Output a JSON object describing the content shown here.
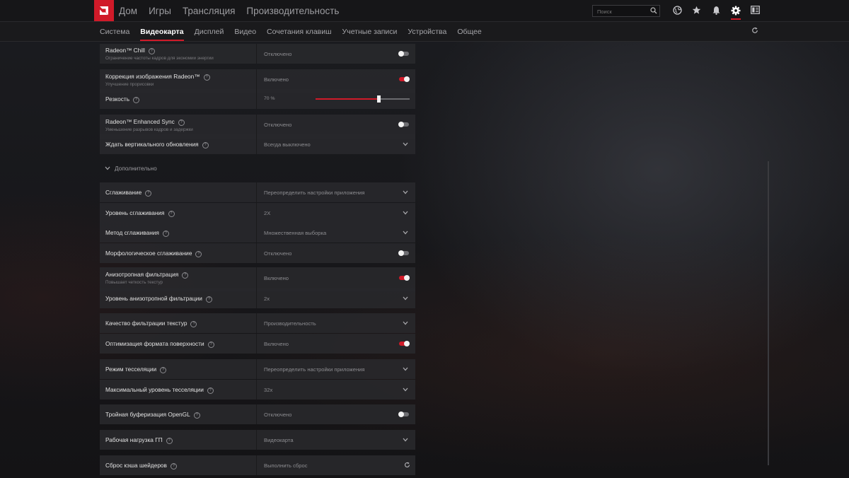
{
  "top_nav": {
    "items": [
      "Дом",
      "Игры",
      "Трансляция",
      "Производительность"
    ],
    "search_placeholder": "Поиск"
  },
  "sub_nav": {
    "tabs": [
      "Система",
      "Видеокарта",
      "Дисплей",
      "Видео",
      "Сочетания клавиш",
      "Учетные записи",
      "Устройства",
      "Общее"
    ],
    "active": "Видеокарта"
  },
  "settings": {
    "chill": {
      "name": "Radeon™ Chill",
      "desc": "Ограничение частоты кадров для экономии энергии",
      "value": "Отключено",
      "on": false
    },
    "image_sharpening": {
      "name": "Коррекция изображения Radeon™",
      "desc": "Улучшение прорисовки",
      "value": "Включено",
      "on": true
    },
    "sharpness": {
      "name": "Резкость",
      "value": "70 %",
      "level": 0.67
    },
    "enhanced_sync": {
      "name": "Radeon™ Enhanced Sync",
      "desc": "Уменьшение разрывов кадров и задержки",
      "value": "Отключено",
      "on": false
    },
    "vsync": {
      "name": "Ждать вертикального обновления",
      "value": "Всегда выключено"
    },
    "advanced_label": "Дополнительно",
    "aa": {
      "name": "Сглаживание",
      "value": "Переопределить настройки приложения"
    },
    "aa_level": {
      "name": "Уровень сглаживания",
      "value": "2X"
    },
    "aa_method": {
      "name": "Метод сглаживания",
      "value": "Множественная выборка"
    },
    "mlaa": {
      "name": "Морфологическое сглаживание",
      "value": "Отключено",
      "on": false
    },
    "aniso": {
      "name": "Анизотропная фильтрация",
      "desc": "Повышает четкость текстур",
      "value": "Включено",
      "on": true
    },
    "aniso_level": {
      "name": "Уровень анизотропной фильтрации",
      "value": "2x"
    },
    "tex_quality": {
      "name": "Качество фильтрации текстур",
      "value": "Производительность"
    },
    "surface_opt": {
      "name": "Оптимизация формата поверхности",
      "value": "Включено",
      "on": true
    },
    "tess_mode": {
      "name": "Режим тесселяции",
      "value": "Переопределить настройки приложения"
    },
    "tess_max": {
      "name": "Максимальный уровень тесселяции",
      "value": "32x"
    },
    "triple_buffer": {
      "name": "Тройная буферизация OpenGL",
      "value": "Отключено",
      "on": false
    },
    "gpu_workload": {
      "name": "Рабочая нагрузка ГП",
      "value": "Видеокарта"
    },
    "shader_cache": {
      "name": "Сброс кэша шейдеров",
      "value": "Выполнить сброс"
    }
  },
  "colors": {
    "accent": "#d01a29",
    "panel": "#28282b",
    "background": "#17171a"
  }
}
